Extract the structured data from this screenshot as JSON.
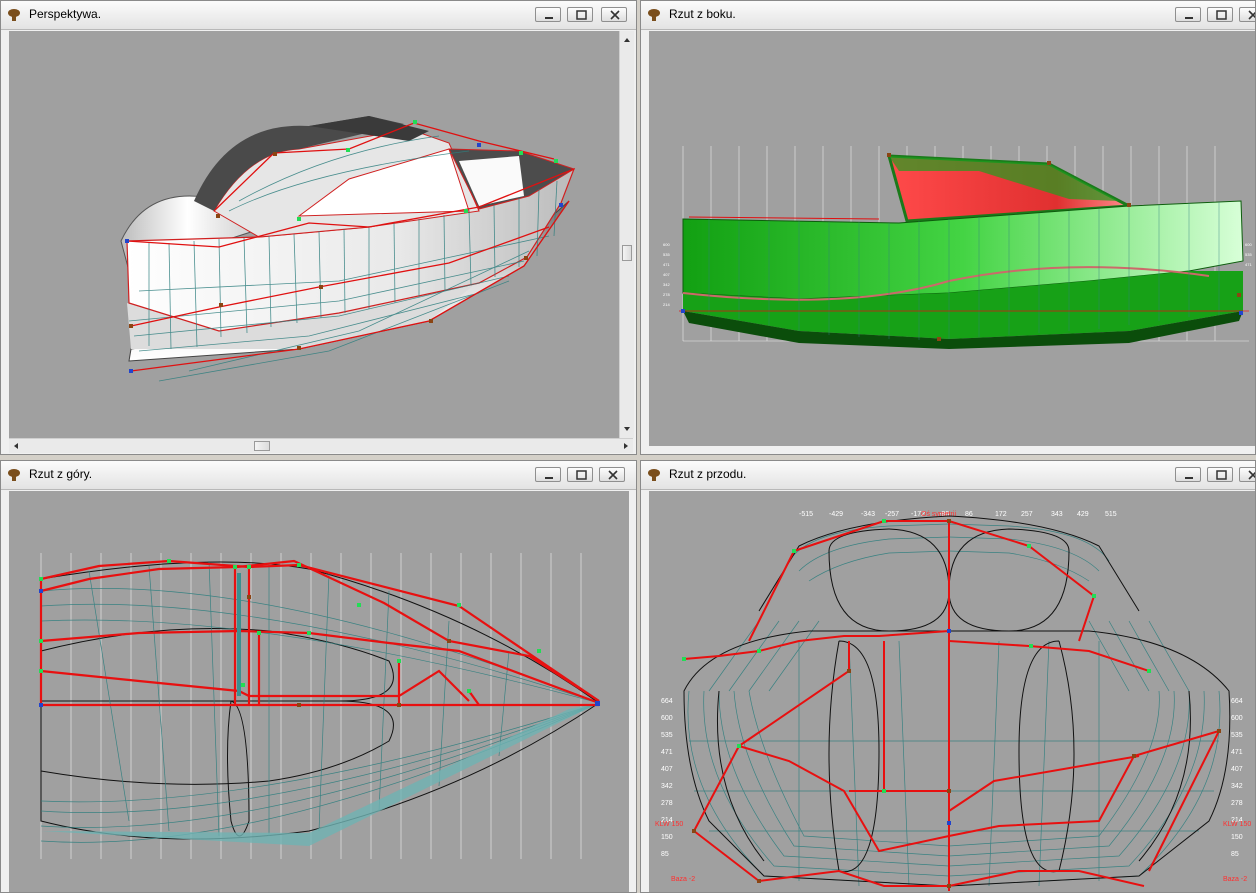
{
  "windows": {
    "perspective": {
      "title": "Perspektywa."
    },
    "side": {
      "title": "Rzut z boku."
    },
    "top": {
      "title": "Rzut z góry."
    },
    "front": {
      "title": "Rzut z przodu.",
      "axis_label": "Oś symetrii",
      "x_ticks": [
        "-515",
        "-429",
        "-343",
        "-257",
        "-172",
        "-86",
        "86",
        "172",
        "257",
        "343",
        "429",
        "515"
      ],
      "y_ticks": [
        "664",
        "600",
        "535",
        "471",
        "407",
        "342",
        "278",
        "214",
        "150",
        "85"
      ],
      "base_left": "Baza -2",
      "base_right": "Baza -2",
      "klw_left": "KLW 150",
      "klw_right": "KLW 150"
    }
  },
  "controls": {
    "minimize": "minimize",
    "restore": "restore",
    "close": "close"
  },
  "colors": {
    "hull_red": "#e81010",
    "grid_teal": "#2f7f7f",
    "node_green": "#22dd55",
    "node_brown": "#8b4513",
    "node_blue": "#2244cc",
    "viewport_gray": "#a0a0a0"
  }
}
